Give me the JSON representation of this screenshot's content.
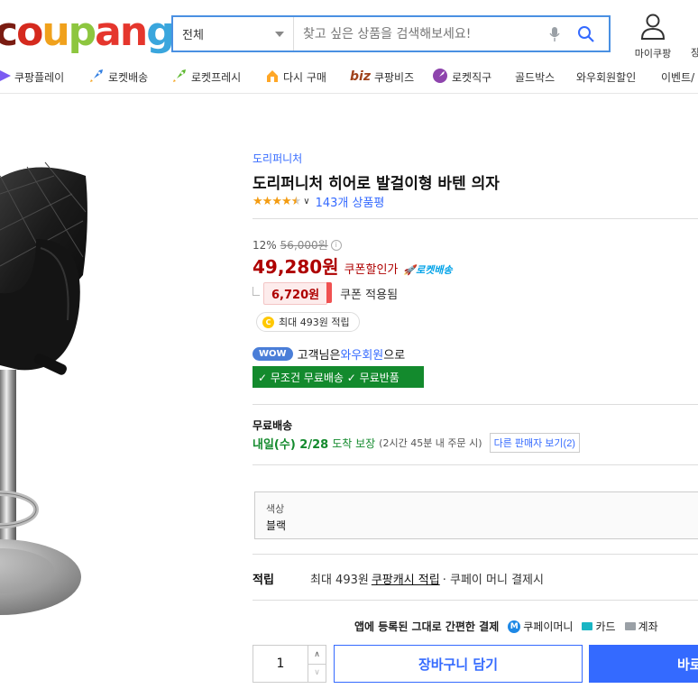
{
  "logo": {
    "text_c1": "c",
    "text_o1": "o",
    "text_u": "u",
    "text_p": "p",
    "text_a": "a",
    "text_n": "n",
    "text_g": "g"
  },
  "search": {
    "category": "전체",
    "placeholder": "찾고 싶은 상품을 검색해보세요!"
  },
  "header": {
    "mycoupang_label": "마이쿠팡",
    "cart_stub": "장"
  },
  "nav": [
    {
      "label": "쿠팡플레이",
      "icon": "play-icon"
    },
    {
      "label": "로켓배송",
      "icon": "rocket-icon"
    },
    {
      "label": "로켓프레시",
      "icon": "rocket-fresh-icon"
    },
    {
      "label": "다시 구매",
      "icon": "rebuy-icon"
    },
    {
      "label": "쿠팡비즈",
      "icon": "biz-icon",
      "prefix": "biz"
    },
    {
      "label": "로켓직구",
      "icon": "global-icon"
    },
    {
      "label": "골드박스",
      "icon": ""
    },
    {
      "label": "와우회원할인",
      "icon": ""
    },
    {
      "label": "이벤트/",
      "icon": ""
    }
  ],
  "product": {
    "brand": "도리퍼니처",
    "title": "도리퍼니처 히어로 발걸이형 바텐 의자",
    "rating": 4.5,
    "review_count": "143개 상품평",
    "discount_rate": "12%",
    "original_price": "56,000원",
    "price": "49,280원",
    "coupon_price_label": "쿠폰할인가",
    "rocket_label": "로켓배송",
    "coupon_amount": "6,720원",
    "coupon_applied": "쿠폰 적용됨",
    "points": "최대 493원 적립",
    "wow_badge": "WOW",
    "wow_pre": "고객님은 ",
    "wow_link": "와우회원",
    "wow_post": "으로",
    "free_bar": "✓ 무조건 무료배송 ✓ 무료반품",
    "shipping_label": "무료배송",
    "shipping_date": "내일(수) 2/28",
    "shipping_ok": "도착 보장",
    "shipping_note": "(2시간 45분 내 주문 시)",
    "other_sellers": "다른 판매자 보기(2)",
    "option_label": "색상",
    "option_value": "블랙",
    "reward_key": "적립",
    "reward_pre": "최대 493원 ",
    "reward_link": "쿠팡캐시 적립",
    "reward_post": "· 쿠페이 머니 결제시",
    "pay_text": "앱에 등록된 그대로 간편한 결제",
    "pay_money": "쿠페이머니",
    "pay_card": "카드",
    "pay_account": "계좌",
    "quantity": "1",
    "cart_button": "장바구니 담기",
    "buy_button": "바로"
  },
  "colors": {
    "accent": "#346aff",
    "price": "#ae0000",
    "green": "#138a2d"
  }
}
